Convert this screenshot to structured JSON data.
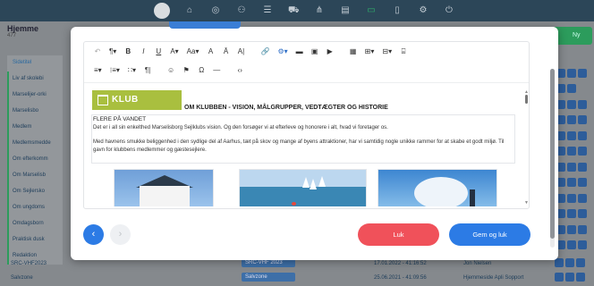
{
  "topbar": {
    "icons": [
      "logo-icon",
      "home-icon",
      "camera-icon",
      "people-icon",
      "list-icon",
      "cart-icon",
      "sitemap-icon",
      "chart-icon",
      "monitor-icon",
      "doc-icon",
      "settings-icon",
      "power-icon"
    ]
  },
  "background": {
    "page_title": "Hjemme",
    "page_sub": "477",
    "list_header": "Sidetitel",
    "list_items": [
      "Liv af skolebi",
      "Marselijer-orki",
      "Marselisbo",
      "Medlem",
      "Medlemsmedde",
      "Om efterkomm",
      "Om Marselisb",
      "Om Sejlersko",
      "Om ungdoms",
      "Omdagsborn",
      "Praktisk dusk",
      "Redaktion"
    ],
    "bottom_rows": [
      {
        "title": "SRC-VHF2023",
        "badge": "SRC-VHF 2023",
        "date": "17.01.2022 - 41:16:52",
        "author": "Jon Nielsen"
      },
      {
        "title": "Salvzone",
        "badge": "Salvzone",
        "date": "25.06.2021 - 41:09:56",
        "author": "Hjemmeside Apli Sopport"
      }
    ]
  },
  "editor": {
    "toolbar_row1": [
      "↶",
      "¶▾",
      "B",
      "I",
      "U",
      "A▾",
      "Aa▾",
      "A",
      "Ā",
      "A|",
      "🔗",
      "⚙▾",
      "▬",
      "▣",
      "▶",
      "▦",
      "⊞▾",
      "⊟▾",
      "⌸"
    ],
    "toolbar_row2": [
      "≡▾",
      "⁝≡▾",
      "∷▾",
      "¶|",
      "☺",
      "⚑",
      "Ω",
      "—",
      "‹›"
    ],
    "logo_text": "KLUB",
    "doc_title": "OM KLUBBEN - VISION, MÅLGRUPPER, VEDTÆGTER OG HISTORIE",
    "heading": "FLERE PÅ VANDET",
    "paragraph1": "Det er i all sin enkelthed Marselisborg Sejlklubs vision. Og den forsøger vi at efterleve og honorere i alt, hvad vi foretager os.",
    "paragraph2": "Med havnens smukke beliggenhed i den sydlige del af Aarhus, tæt på skov og mange af byens attraktioner, har vi samtidig nogle unikke rammer for at skabe et godt miljø. Til gavn for klubbens medlemmer og gæstesejlere."
  },
  "footer": {
    "prev_icon": "‹",
    "next_icon": "›",
    "close_label": "Luk",
    "save_label": "Gem og luk"
  }
}
